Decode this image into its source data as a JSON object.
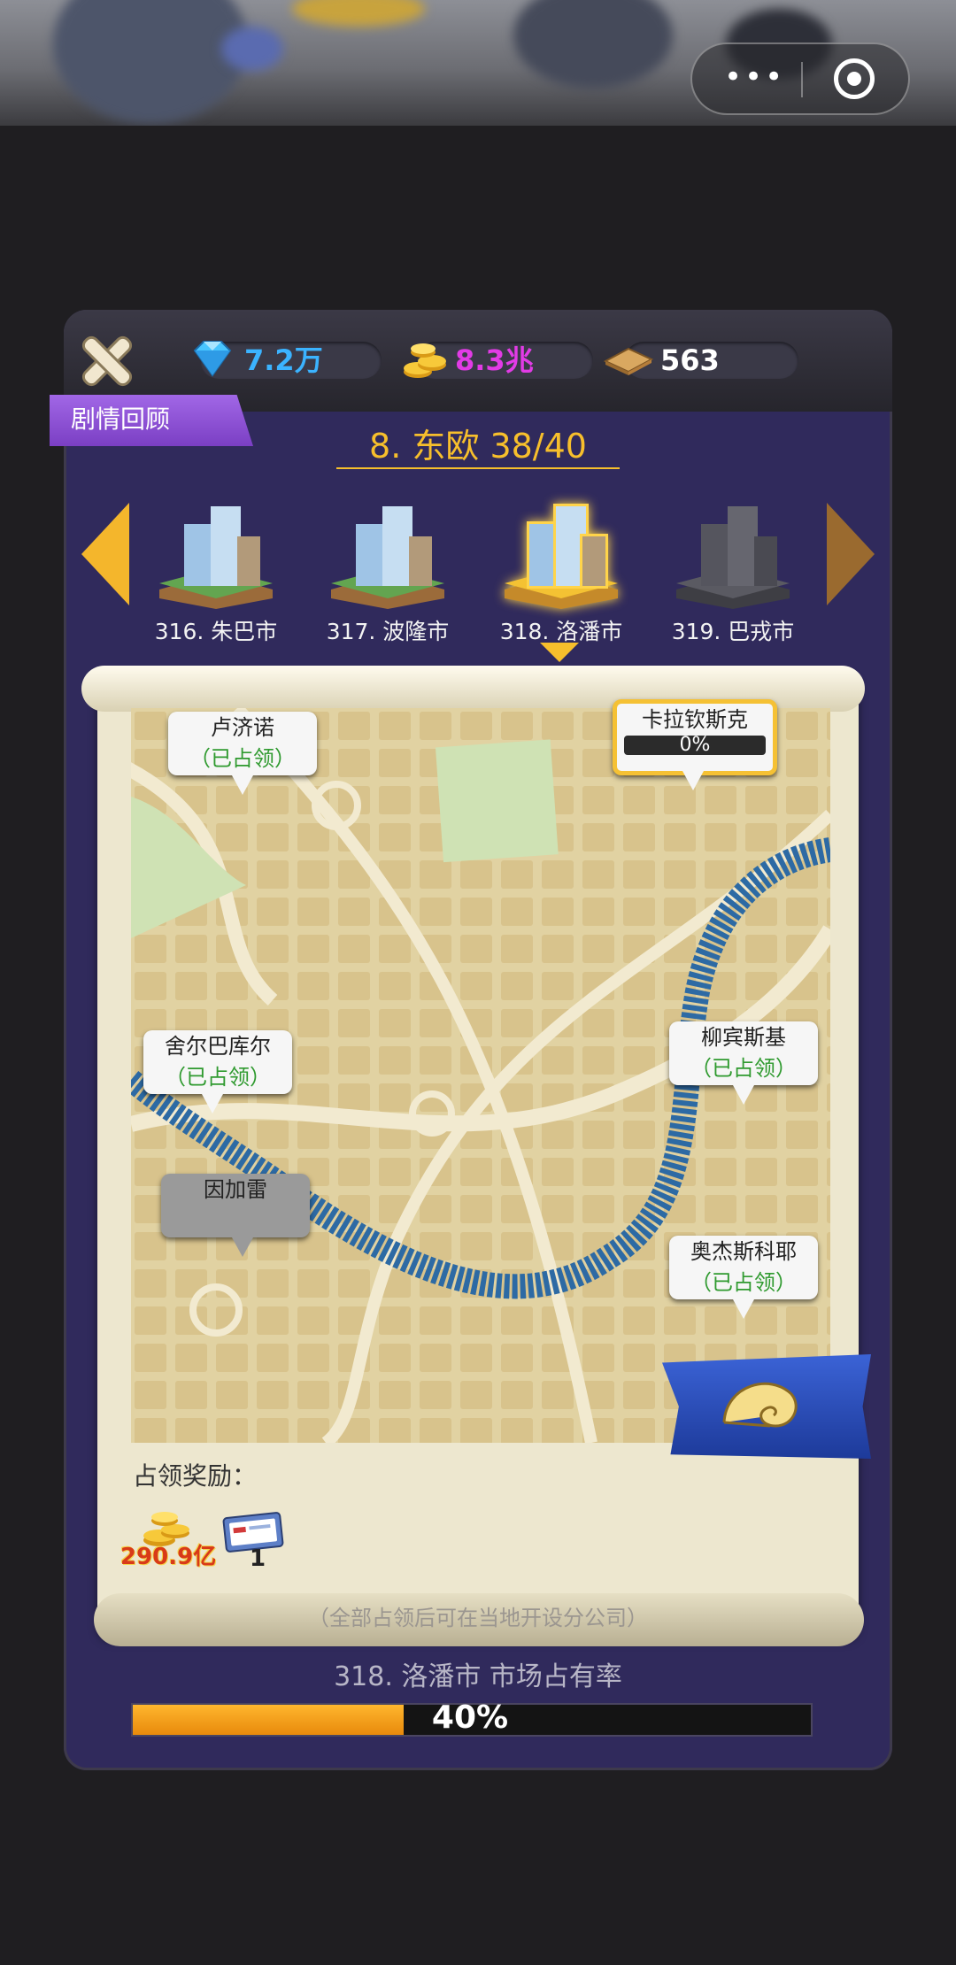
{
  "resources": {
    "diamond_value": "7.2万",
    "gold_value": "8.3兆",
    "ticket_value": "563"
  },
  "ribbon_label": "剧情回顾",
  "chapter_title": "8. 东欧 38/40",
  "cities": [
    {
      "label": "316. 朱巴市",
      "state": "conquered"
    },
    {
      "label": "317. 波隆市",
      "state": "conquered"
    },
    {
      "label": "318. 洛潘市",
      "state": "selected"
    },
    {
      "label": "319. 巴戎市",
      "state": "locked"
    }
  ],
  "districts": {
    "d1": {
      "name": "卢济诺",
      "status": "（已占领）"
    },
    "d2": {
      "name": "卡拉钦斯克",
      "progress_text": "0%",
      "progress": 0
    },
    "d3": {
      "name": "舍尔巴库尔",
      "status": "（已占领）"
    },
    "d4": {
      "name": "柳宾斯基",
      "status": "（已占领）"
    },
    "d5": {
      "name": "因加雷"
    },
    "d6": {
      "name": "奥杰斯科耶",
      "status": "（已占领）"
    }
  },
  "reward": {
    "title": "占领奖励：",
    "coin_value": "290.9亿",
    "ticket_count": "1"
  },
  "footnote": "（全部占领后可在当地开设分公司）",
  "market_share": {
    "label": "318. 洛潘市 市场占有率",
    "percent_text": "40%",
    "percent": 40
  },
  "colors": {
    "accent_gold": "#f7bf2c",
    "panel": "#302a5c",
    "diamond_text": "#3bb3ff",
    "gold_text": "#e23be6",
    "occupied_green": "#2f9a2f"
  }
}
